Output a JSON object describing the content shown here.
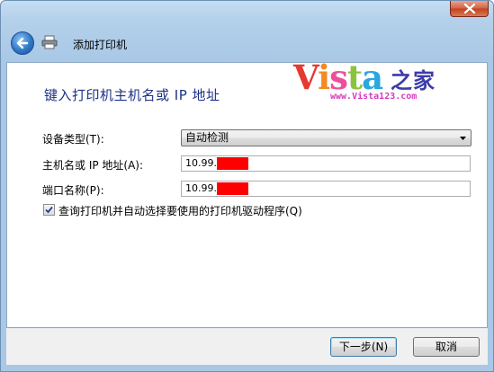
{
  "window": {
    "title": "添加打印机",
    "close_icon": "close-icon",
    "back_icon": "back-arrow-icon",
    "printer_icon": "printer-icon"
  },
  "logo": {
    "text_letters": [
      "V",
      "i",
      "s",
      "t",
      "a"
    ],
    "text_cn": "之家",
    "url": "www.Vista123.com"
  },
  "main": {
    "heading": "键入打印机主机名或 IP 地址",
    "device_type": {
      "label": "设备类型(T):",
      "selected": "自动检测"
    },
    "hostname": {
      "label": "主机名或 IP 地址(A):",
      "value": "10.99."
    },
    "port": {
      "label": "端口名称(P):",
      "value": "10.99."
    },
    "query_printer": {
      "checked": true,
      "label": "查询打印机并自动选择要使用的打印机驱动程序(Q)"
    }
  },
  "footer": {
    "next_label": "下一步(N)",
    "cancel_label": "取消"
  },
  "colors": {
    "heading": "#1e3287",
    "redaction": "#ff0000",
    "close_button": "#c2401f"
  }
}
